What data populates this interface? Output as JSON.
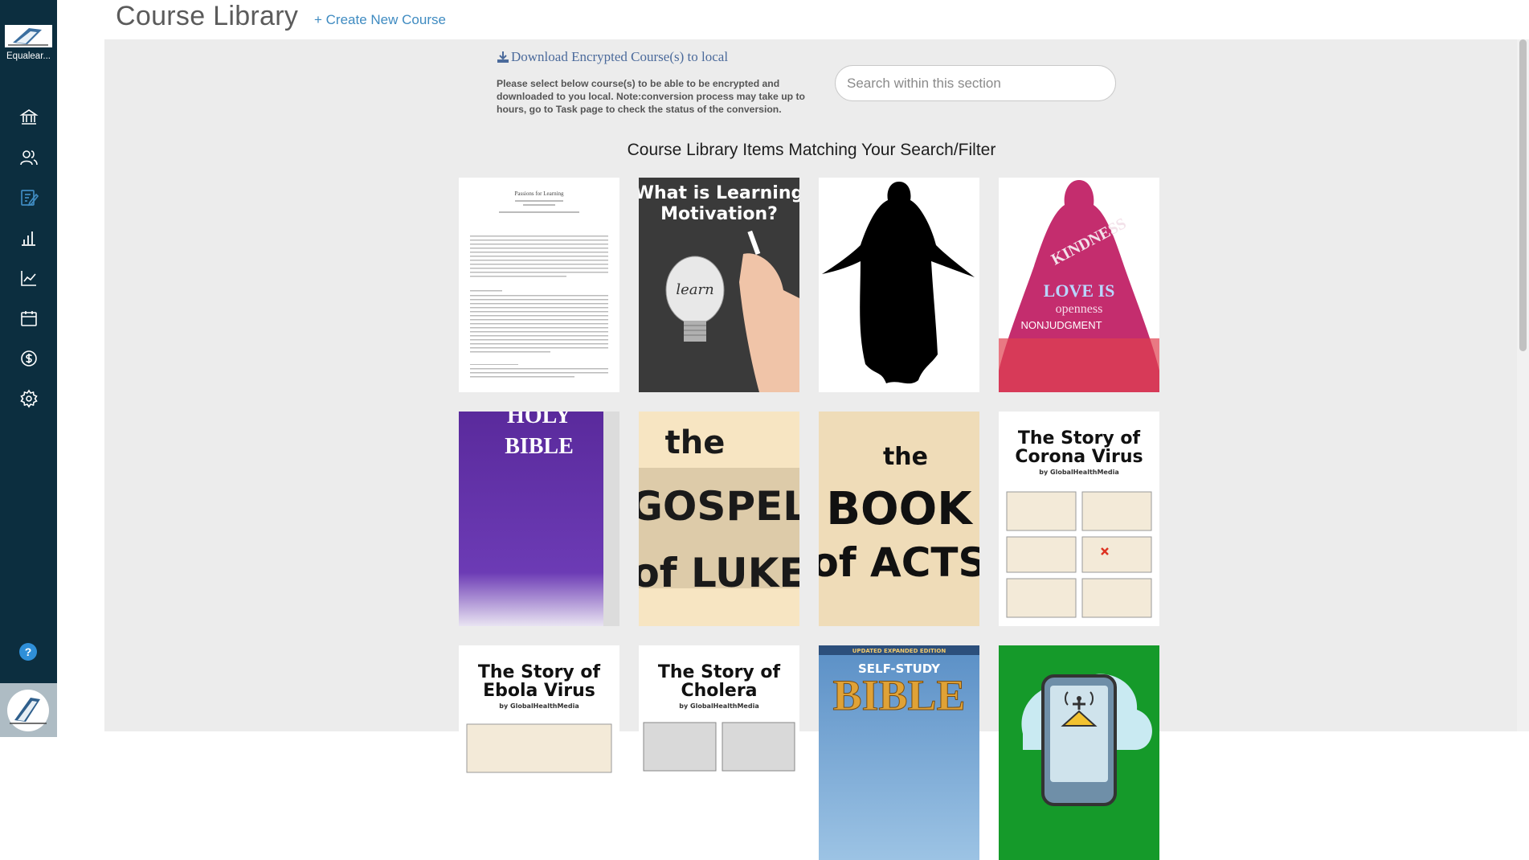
{
  "app": {
    "name": "Equalear..."
  },
  "header": {
    "title": "Course Library",
    "create_link": "+ Create New Course"
  },
  "download": {
    "link_label": "Download Encrypted Course(s) to local",
    "instructions": "Please select below course(s) to be able to be encrypted and downloaded to you local. Note:conversion process may take up to hours, go to Task page to check the status of the conversion."
  },
  "search": {
    "placeholder": "Search within this section",
    "value": ""
  },
  "section_heading": "Course Library Items Matching Your Search/Filter",
  "sidebar": {
    "items": [
      {
        "icon": "institution-icon"
      },
      {
        "icon": "users-icon"
      },
      {
        "icon": "courses-icon",
        "active": true
      },
      {
        "icon": "bar-chart-icon"
      },
      {
        "icon": "line-chart-icon"
      },
      {
        "icon": "calendar-icon"
      },
      {
        "icon": "dollar-icon"
      },
      {
        "icon": "settings-icon"
      }
    ],
    "help_label": "?"
  },
  "courses": [
    {
      "cover_text": [
        "Passions for Learning"
      ]
    },
    {
      "cover_text": [
        "What is Learning",
        "Motivation?",
        "learn"
      ]
    },
    {
      "cover_text": []
    },
    {
      "cover_text": [
        "KINDNESS",
        "LOVE IS",
        "openness",
        "NONJUDGMENT"
      ]
    },
    {
      "cover_text": [
        "HOLY",
        "BIBLE"
      ]
    },
    {
      "cover_text": [
        "the",
        "GOSPEL",
        "of LUKE"
      ]
    },
    {
      "cover_text": [
        "the",
        "BOOK",
        "of ACTS"
      ]
    },
    {
      "cover_text": [
        "The Story of",
        "Corona Virus",
        "by GlobalHealthMedia"
      ]
    },
    {
      "cover_text": [
        "The Story of",
        "Ebola Virus",
        "by GlobalHealthMedia"
      ]
    },
    {
      "cover_text": [
        "The Story of",
        "Cholera",
        "by GlobalHealthMedia"
      ]
    },
    {
      "cover_text": [
        "UPDATED EXPANDED EDITION",
        "SELF-STUDY",
        "BIBLE"
      ]
    },
    {
      "cover_text": []
    }
  ],
  "colors": {
    "sidebar": "#0c2e3f",
    "accent": "#3f8bc1",
    "content_bg": "#ececec"
  }
}
